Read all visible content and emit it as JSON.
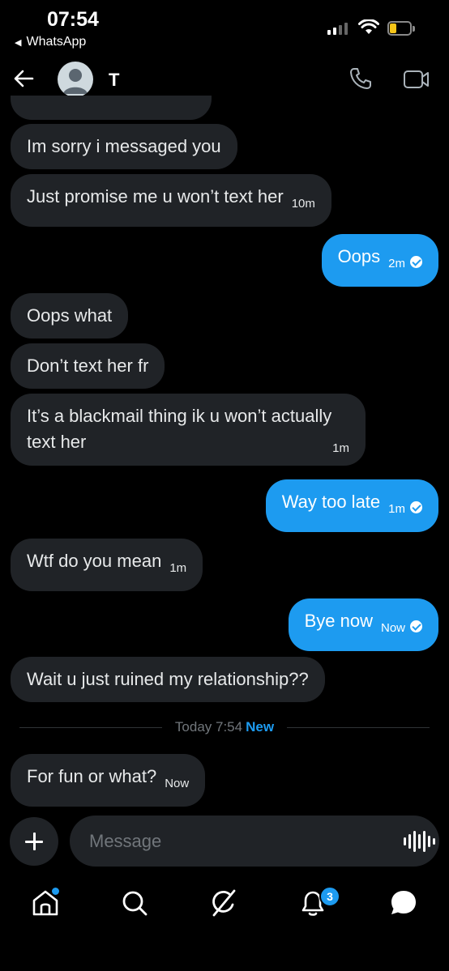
{
  "status_bar": {
    "time": "07:54",
    "back_app": "WhatsApp",
    "battery": "8"
  },
  "header": {
    "contact_name": "T"
  },
  "messages": [
    {
      "dir": "in",
      "text": "Im sorry i messaged you",
      "time": ""
    },
    {
      "dir": "in",
      "text": "Just promise me u won’t text her",
      "time": "10m"
    },
    {
      "dir": "out",
      "text": "Oops",
      "time": "2m"
    },
    {
      "dir": "in",
      "text": "Oops what",
      "time": ""
    },
    {
      "dir": "in",
      "text": "Don’t text her fr",
      "time": ""
    },
    {
      "dir": "in",
      "text": "It’s a blackmail thing ik u won’t actually",
      "text2": "text her",
      "time": "1m"
    },
    {
      "dir": "out",
      "text": "Way too late",
      "time": "1m"
    },
    {
      "dir": "in",
      "text": "Wtf do you mean",
      "time": "1m"
    },
    {
      "dir": "out",
      "text": "Bye now",
      "time": "Now"
    },
    {
      "dir": "in",
      "text": "Wait u just ruined my relationship??",
      "time": ""
    },
    {
      "dir": "in",
      "text": "For fun or what?",
      "time": "Now"
    }
  ],
  "divider": {
    "time": "Today 7:54",
    "new_label": "New"
  },
  "composer": {
    "placeholder": "Message"
  },
  "nav": {
    "notifications_count": "3"
  },
  "colors": {
    "accent": "#1d9bf0",
    "incoming_bubble": "#202327",
    "background": "#000000"
  }
}
